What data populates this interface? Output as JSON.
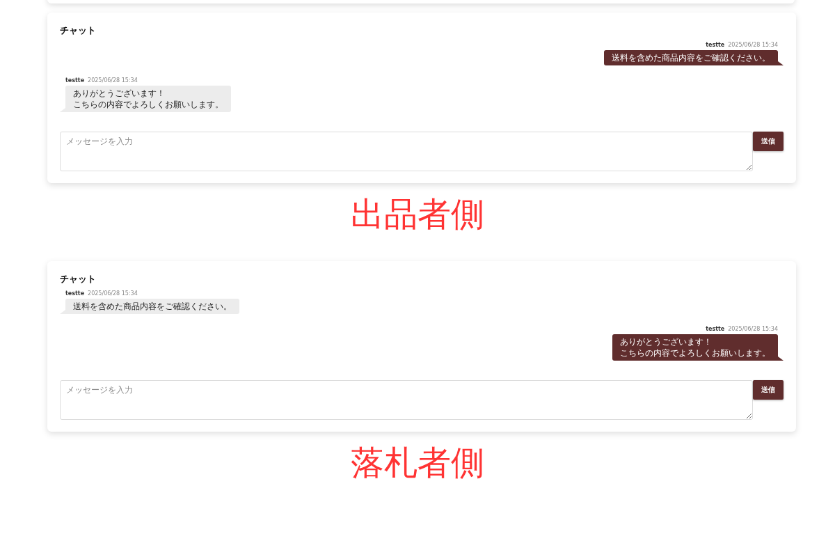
{
  "panels": [
    {
      "title": "チャット",
      "messages": [
        {
          "mine": true,
          "user": "testte",
          "time": "2025/06/28 15:34",
          "lines": [
            "送料を含めた商品内容をご確認ください。"
          ]
        },
        {
          "mine": false,
          "user": "testte",
          "time": "2025/06/28 15:34",
          "lines": [
            "ありがとうございます！",
            "こちらの内容でよろしくお願いします。"
          ]
        }
      ],
      "placeholder": "メッセージを入力",
      "send": "送信",
      "caption": "出品者側"
    },
    {
      "title": "チャット",
      "messages": [
        {
          "mine": false,
          "user": "testte",
          "time": "2025/06/28 15:34",
          "lines": [
            "送料を含めた商品内容をご確認ください。"
          ]
        },
        {
          "mine": true,
          "user": "testte",
          "time": "2025/06/28 15:34",
          "lines": [
            "ありがとうございます！",
            "こちらの内容でよろしくお願いします。"
          ]
        }
      ],
      "placeholder": "メッセージを入力",
      "send": "送信",
      "caption": "落札者側"
    }
  ]
}
